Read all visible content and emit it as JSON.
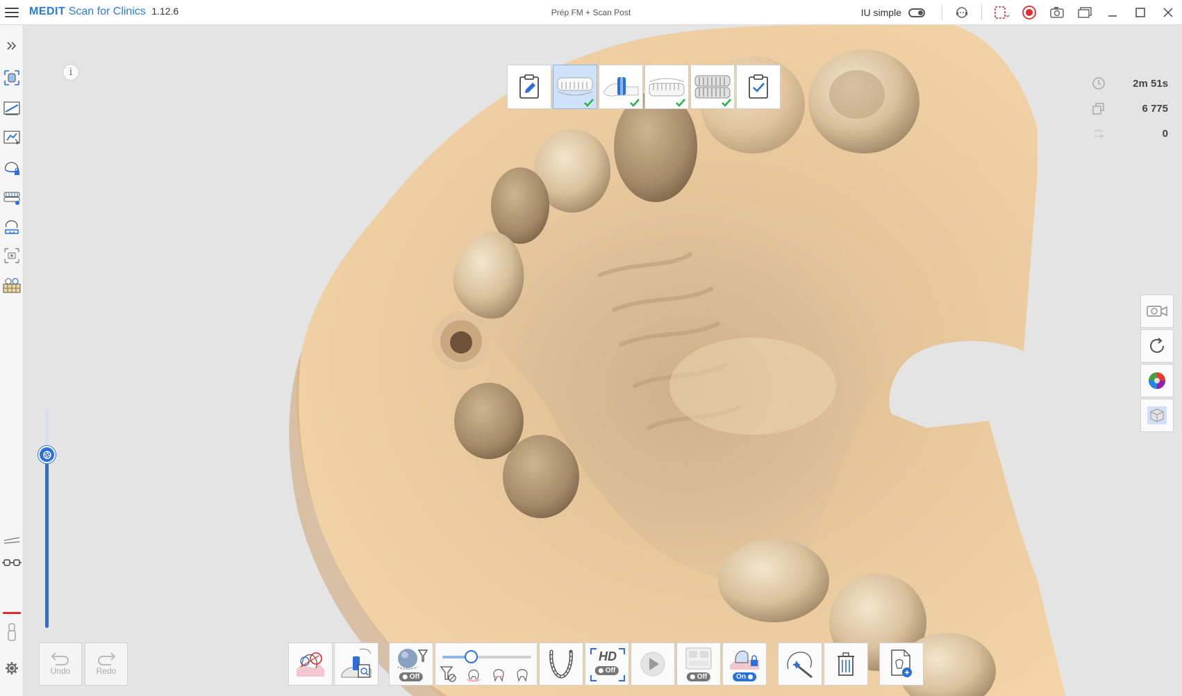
{
  "app": {
    "brand": "MEDIT",
    "name": "Scan for Clinics",
    "version": "1.12.6"
  },
  "document_title": "Prép FM + Scan Post",
  "mode": {
    "label": "IU simple",
    "toggle_on": false
  },
  "stats": {
    "time": "2m 51s",
    "frames": "6 775",
    "rotations": "0"
  },
  "history": {
    "undo_label": "Undo",
    "redo_label": "Redo"
  },
  "info_glyph": "i",
  "stages": [
    {
      "name": "prescription",
      "icon": "clipboard-pencil-icon",
      "checked": false
    },
    {
      "name": "maxilla",
      "icon": "upper-jaw-icon",
      "checked": true,
      "active": true
    },
    {
      "name": "scanbody",
      "icon": "scanbody-icon",
      "checked": true
    },
    {
      "name": "mandible",
      "icon": "lower-jaw-icon",
      "checked": true
    },
    {
      "name": "occlusion",
      "icon": "occlusion-icon",
      "checked": true
    },
    {
      "name": "review",
      "icon": "clipboard-check-icon",
      "checked": false
    }
  ],
  "toolbar": {
    "hd_label": "HD",
    "filter_state": "Off",
    "hd_state": "Off",
    "ai_state": "Off",
    "lock_state": "On"
  },
  "colors": {
    "accent": "#2a6fdb",
    "brand": "#2a7be0",
    "record": "#e22b2b",
    "model": "#e8c79b"
  }
}
